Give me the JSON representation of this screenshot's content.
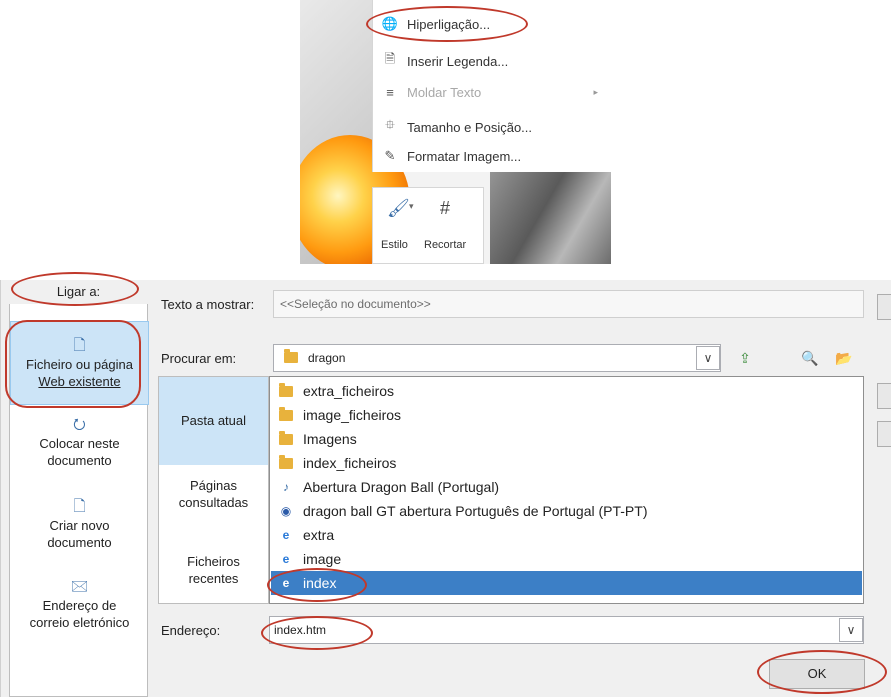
{
  "context_menu": {
    "items": [
      {
        "label": "Hiperligação...",
        "icon": "hyperlink-icon",
        "disabled": false
      },
      {
        "label": "Inserir Legenda...",
        "icon": "caption-icon",
        "disabled": false
      },
      {
        "label": "Moldar Texto",
        "icon": "wrap-text-icon",
        "disabled": true,
        "submenu": true
      },
      {
        "label": "Tamanho e Posição...",
        "icon": "size-position-icon",
        "disabled": false
      },
      {
        "label": "Formatar Imagem...",
        "icon": "format-image-icon",
        "disabled": false
      }
    ],
    "mini_toolbar": {
      "style_label": "Estilo",
      "crop_label": "Recortar"
    }
  },
  "dialog": {
    "link_to_label": "Ligar a:",
    "left_items": [
      {
        "line1": "Ficheiro ou página",
        "line2": "Web existente",
        "icon": "web-page-icon",
        "selected": true
      },
      {
        "line1": "Colocar neste",
        "line2": "documento",
        "icon": "place-in-document-icon",
        "selected": false
      },
      {
        "line1": "Criar novo",
        "line2": "documento",
        "icon": "new-document-icon",
        "selected": false
      },
      {
        "line1": "Endereço de",
        "line2": "correio eletrónico",
        "icon": "email-address-icon",
        "selected": false
      }
    ],
    "text_to_display_label": "Texto a mostrar:",
    "text_to_display_value": "<<Seleção no documento>>",
    "look_in_label": "Procurar em:",
    "look_in_value": "dragon",
    "side_items": [
      {
        "line1": "Pasta atual",
        "line2": "",
        "selected": true
      },
      {
        "line1": "Páginas",
        "line2": "consultadas",
        "selected": false
      },
      {
        "line1": "Ficheiros",
        "line2": "recentes",
        "selected": false
      }
    ],
    "files": [
      {
        "name": "extra_ficheiros",
        "type": "folder"
      },
      {
        "name": "image_ficheiros",
        "type": "folder"
      },
      {
        "name": "Imagens",
        "type": "folder"
      },
      {
        "name": "index_ficheiros",
        "type": "folder"
      },
      {
        "name": "Abertura Dragon Ball (Portugal)",
        "type": "audio"
      },
      {
        "name": "dragon ball GT abertura Português de Portugal (PT-PT)",
        "type": "video"
      },
      {
        "name": "extra",
        "type": "html"
      },
      {
        "name": "image",
        "type": "html"
      },
      {
        "name": "index",
        "type": "html",
        "selected": true
      }
    ],
    "address_label": "Endereço:",
    "address_value": "index.htm",
    "ok_label": "OK"
  },
  "colors": {
    "selection": "#3c7fc6",
    "highlight_oval": "#c0392b",
    "folder": "#e8b23c"
  }
}
